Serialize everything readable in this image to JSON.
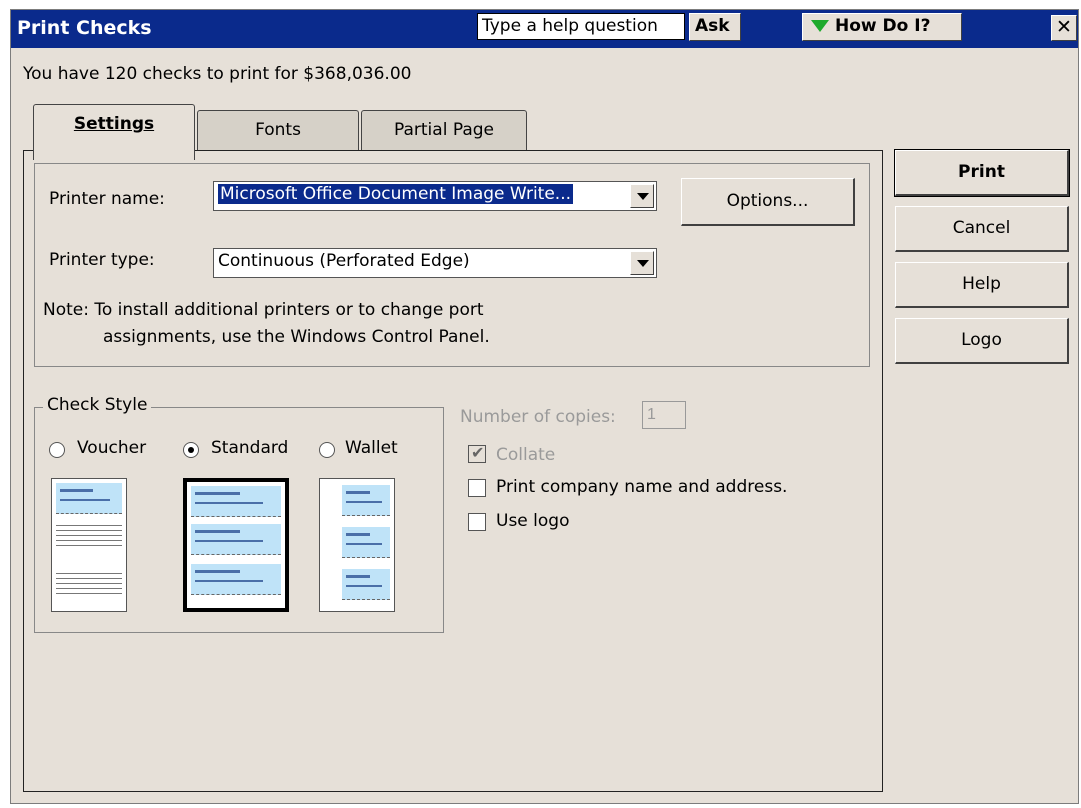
{
  "window": {
    "title": "Print Checks",
    "help_placeholder": "Type a help question",
    "ask_label": "Ask",
    "howdoi_label": "How Do I?",
    "close_label": "✕"
  },
  "summary": "You have 120 checks to print for $368,036.00",
  "tabs": [
    {
      "label": "Settings",
      "active": true
    },
    {
      "label": "Fonts",
      "active": false
    },
    {
      "label": "Partial Page",
      "active": false
    }
  ],
  "settings": {
    "printer_name_label": "Printer name:",
    "printer_name_value": "Microsoft Office Document Image Write...",
    "options_label": "Options...",
    "printer_type_label": "Printer type:",
    "printer_type_value": "Continuous (Perforated Edge)",
    "note_line1": "Note: To install additional printers or to change port",
    "note_line2": "assignments, use the Windows Control Panel."
  },
  "check_style": {
    "legend": "Check Style",
    "options": [
      {
        "label": "Voucher",
        "selected": false
      },
      {
        "label": "Standard",
        "selected": true
      },
      {
        "label": "Wallet",
        "selected": false
      }
    ]
  },
  "copies": {
    "label": "Number of copies:",
    "value": "1",
    "collate_label": "Collate",
    "collate_checked": true,
    "collate_enabled": false
  },
  "options": {
    "print_company_label": "Print company name and address.",
    "print_company_checked": false,
    "use_logo_label": "Use logo",
    "use_logo_checked": false
  },
  "buttons": {
    "print": "Print",
    "cancel": "Cancel",
    "help": "Help",
    "logo": "Logo"
  },
  "colors": {
    "titlebar": "#0a2a8c",
    "dialog_bg": "#e6e0d8",
    "check_blue": "#bfe3f8",
    "howdoi_arrow": "#1eaa2c"
  }
}
